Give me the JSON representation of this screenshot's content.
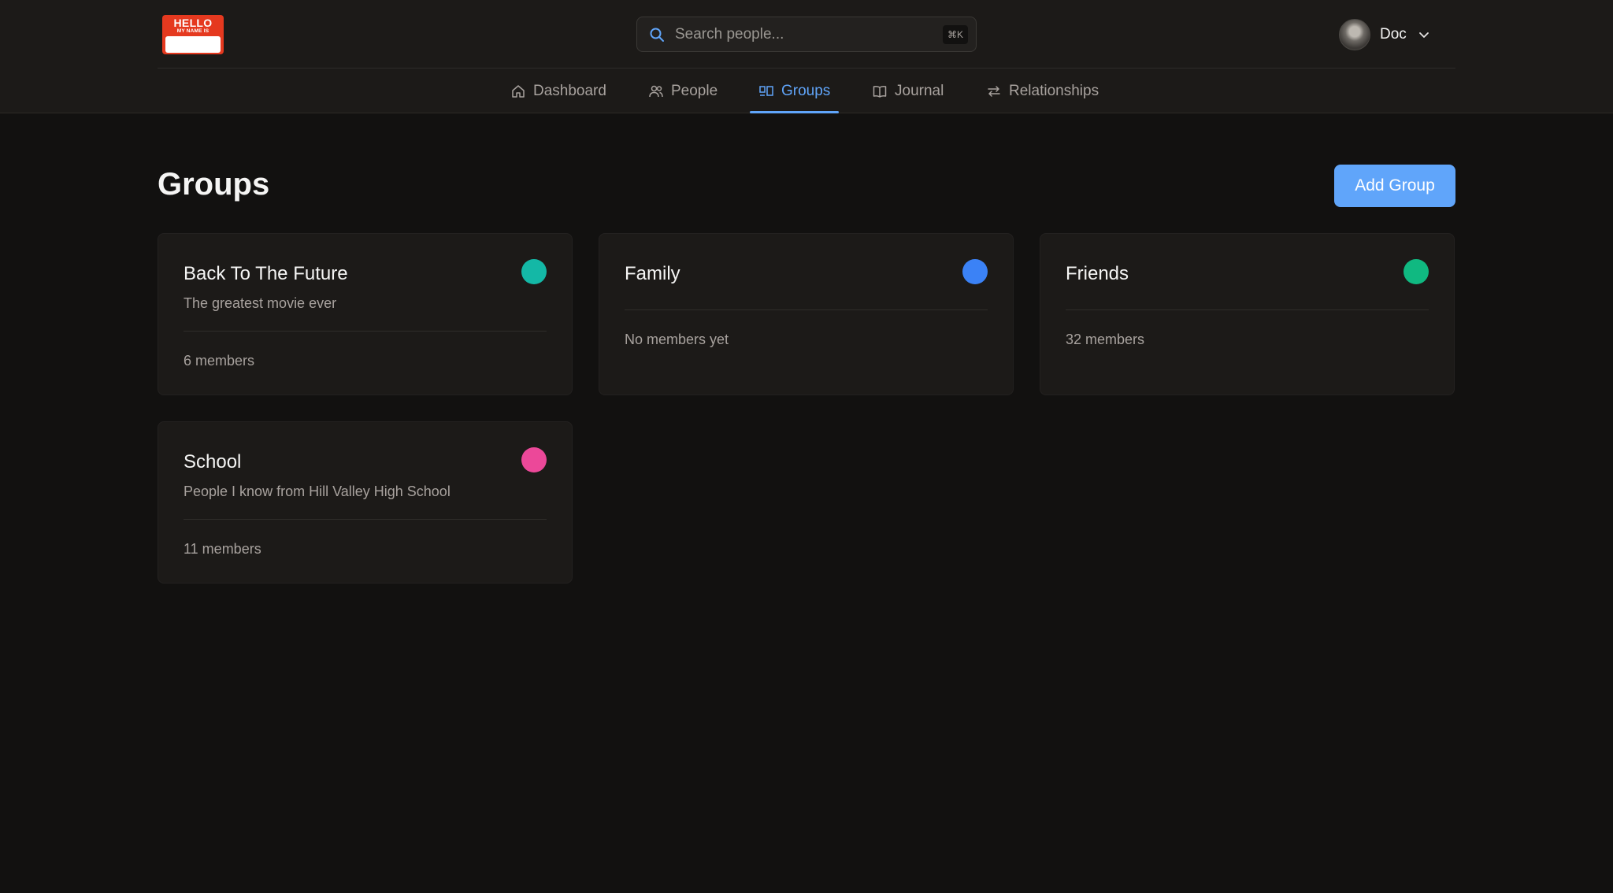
{
  "logo": {
    "hello": "HELLO",
    "my_name_is": "MY NAME IS"
  },
  "search": {
    "placeholder": "Search people...",
    "shortcut": "⌘K"
  },
  "user": {
    "name": "Doc"
  },
  "nav": {
    "items": [
      {
        "label": "Dashboard",
        "icon": "home-icon"
      },
      {
        "label": "People",
        "icon": "users-icon"
      },
      {
        "label": "Groups",
        "icon": "groups-icon",
        "active": true
      },
      {
        "label": "Journal",
        "icon": "book-icon"
      },
      {
        "label": "Relationships",
        "icon": "arrows-icon"
      }
    ]
  },
  "page": {
    "title": "Groups",
    "add_button": "Add Group"
  },
  "groups": [
    {
      "name": "Back To The Future",
      "description": "The greatest movie ever",
      "members": "6 members",
      "color": "#14b8a6"
    },
    {
      "name": "Family",
      "description": "",
      "members": "No members yet",
      "color": "#3b82f6"
    },
    {
      "name": "Friends",
      "description": "",
      "members": "32 members",
      "color": "#10b981"
    },
    {
      "name": "School",
      "description": "People I know from Hill Valley High School",
      "members": "11 members",
      "color": "#ec4899"
    }
  ]
}
